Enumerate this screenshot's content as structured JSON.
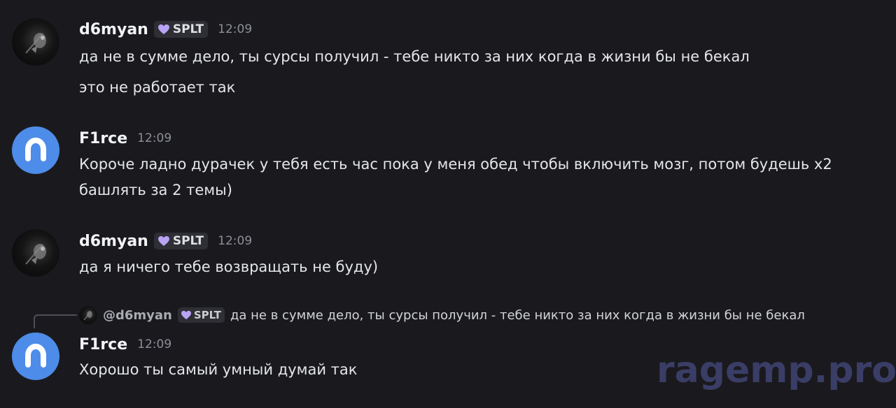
{
  "messages": [
    {
      "author": "d6myan",
      "tag": "SPLT",
      "time": "12:09",
      "avatar_icon": "astronaut-avatar-icon",
      "lines": [
        "да не в сумме дело, ты сурсы получил - тебе никто за них когда в жизни бы не бекал",
        "это не работает так"
      ]
    },
    {
      "author": "F1rce",
      "time": "12:09",
      "avatar_icon": "discord-default-avatar-icon",
      "lines": [
        "Короче ладно дурачек у тебя есть час пока у меня обед чтобы включить мозг, потом будешь х2",
        "башлять за 2 темы)"
      ]
    },
    {
      "author": "d6myan",
      "tag": "SPLT",
      "time": "12:09",
      "avatar_icon": "astronaut-avatar-icon",
      "lines": [
        "да я ничего тебе возвращать не буду)"
      ]
    },
    {
      "author": "F1rce",
      "time": "12:09",
      "avatar_icon": "discord-default-avatar-icon",
      "reply": {
        "mention": "@d6myan",
        "tag": "SPLT",
        "text": "да не в сумме дело, ты сурсы получил - тебе никто за них когда в жизни бы не бекал"
      },
      "lines": [
        "Хорошо ты самый умный думай так"
      ]
    }
  ],
  "watermark": "ragemp.pro",
  "colors": {
    "background": "#1a1a1e",
    "tag_heart": "#b9a3f5",
    "blue_avatar": "#4d8ce8",
    "watermark": "#3a3d66"
  }
}
